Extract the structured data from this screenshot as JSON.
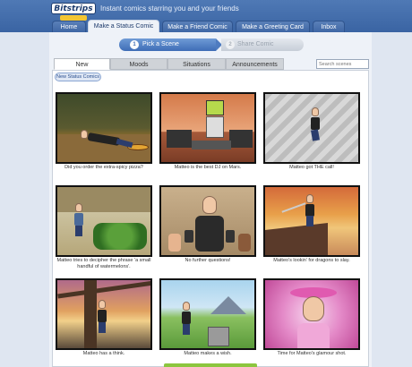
{
  "header": {
    "logo_text": "Bitstrips",
    "tagline": "Instant comics starring you and your friends"
  },
  "nav_tabs": [
    {
      "label": "Home",
      "active": false
    },
    {
      "label": "Make a Status Comic",
      "active": true
    },
    {
      "label": "Make a Friend Comic",
      "active": false
    },
    {
      "label": "Make a Greeting Card",
      "active": false
    },
    {
      "label": "Inbox",
      "active": false
    }
  ],
  "steps": [
    {
      "num": "1",
      "label": "Pick a Scene",
      "active": true
    },
    {
      "num": "2",
      "label": "Share Comic",
      "active": false
    }
  ],
  "category_tabs": [
    {
      "label": "New",
      "active": true
    },
    {
      "label": "Moods",
      "active": false
    },
    {
      "label": "Situations",
      "active": false
    },
    {
      "label": "Announcements",
      "active": false
    }
  ],
  "search": {
    "placeholder": "Search scenes"
  },
  "filter_badge": "New Status Comics",
  "comics": [
    {
      "caption": "Did you order the extra-spicy pizza?",
      "scene": "lying on floor eating pizza"
    },
    {
      "caption": "Matteo is the best DJ on Mars.",
      "scene": "DJ on Mars with robot"
    },
    {
      "caption": "Matteo got THE call!",
      "scene": "running down stairs with phone"
    },
    {
      "caption": "Matteo tries to decipher the phrase 'a small handful of watermelons'.",
      "scene": "at grocery store with watermelons"
    },
    {
      "caption": "No further questions!",
      "scene": "press conference microphones"
    },
    {
      "caption": "Matteo's lookin' for dragons to slay.",
      "scene": "on cliff with sword at sunset"
    },
    {
      "caption": "Matteo has a think.",
      "scene": "leaning on tree at sunset"
    },
    {
      "caption": "Matteo makes a wish.",
      "scene": "at wishing well in meadow"
    },
    {
      "caption": "Time for Matteo's glamour shot.",
      "scene": "pink glamour portrait with hat"
    }
  ]
}
